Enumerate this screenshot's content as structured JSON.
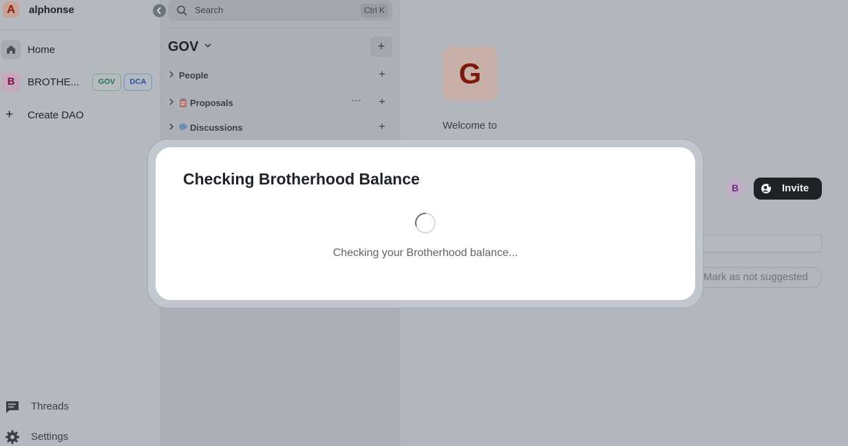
{
  "user": {
    "avatar_letter": "A",
    "name": "alphonse"
  },
  "sidebar": {
    "items": [
      {
        "label": "Home",
        "icon": "home-icon"
      },
      {
        "label": "BROTHE...",
        "avatar_letter": "B",
        "badges": [
          "GOV",
          "DCA"
        ]
      },
      {
        "label": "Create DAO",
        "icon": "plus-icon"
      }
    ],
    "bottom": [
      {
        "label": "Threads",
        "icon": "threads-icon"
      },
      {
        "label": "Settings",
        "icon": "gear-icon"
      }
    ]
  },
  "channels": {
    "search_placeholder": "Search",
    "shortcut": "Ctrl K",
    "space_title": "GOV",
    "sections": [
      {
        "label": "People",
        "icon": ""
      },
      {
        "label": "Proposals",
        "icon": "clipboard-icon",
        "has_more": true
      },
      {
        "label": "Discussions",
        "icon": "speech-bubble-icon"
      }
    ]
  },
  "main": {
    "avatar_letter": "G",
    "welcome_text": "Welcome to",
    "member_letter": "B",
    "invite_label": "Invite",
    "not_suggested_label": "Mark as not suggested"
  },
  "modal": {
    "title": "Checking Brotherhood Balance",
    "message": "Checking your Brotherhood balance..."
  },
  "colors": {
    "accent_dark": "#1f2124",
    "overlay": "#b3b7bd",
    "modal_bg": "#ffffff",
    "gov_badge": "#2d6b5e",
    "dca_badge": "#2c4f94"
  }
}
